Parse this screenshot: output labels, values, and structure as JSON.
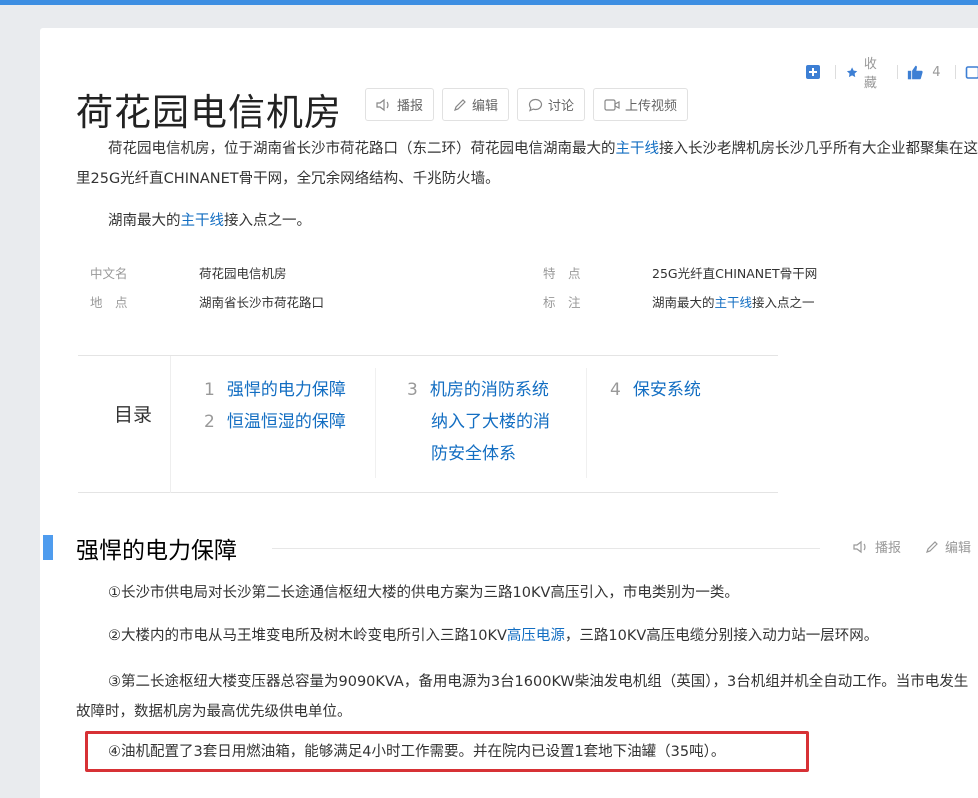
{
  "toolbar": {
    "favorite_label": "收藏",
    "like_count": "4"
  },
  "title": "荷花园电信机房",
  "title_buttons": {
    "broadcast": "播报",
    "edit": "编辑",
    "discuss": "讨论",
    "upload_video": "上传视频"
  },
  "summary": {
    "p1_a": "荷花园电信机房，位于湖南省长沙市荷花路口（东二环）荷花园电信湖南最大的",
    "p1_link": "主干线",
    "p1_b": "接入长沙老牌机房长沙几乎所有大企业都聚集在这里25G光纤直CHINANET骨干网，全冗余网络结构、千兆防火墙。",
    "p2_a": "湖南最大的",
    "p2_link": "主干线",
    "p2_b": "接入点之一。"
  },
  "infobox": {
    "left": [
      {
        "key": "中文名",
        "value": "荷花园电信机房"
      },
      {
        "key": "地　点",
        "value": "湖南省长沙市荷花路口"
      }
    ],
    "right": [
      {
        "key": "特　点",
        "value": "25G光纤直CHINANET骨干网"
      },
      {
        "key": "标　注",
        "value_a": "湖南最大的",
        "value_link": "主干线",
        "value_b": "接入点之一"
      }
    ]
  },
  "toc": {
    "label": "目录",
    "items": [
      {
        "num": "1",
        "text": "强悍的电力保障"
      },
      {
        "num": "2",
        "text": "恒温恒湿的保障"
      },
      {
        "num": "3",
        "line1": "机房的消防系统",
        "line2": "纳入了大楼的消",
        "line3": "防安全体系"
      },
      {
        "num": "4",
        "text": "保安系统"
      }
    ]
  },
  "section": {
    "title": "强悍的电力保障",
    "broadcast": "播报",
    "edit": "编辑",
    "p1": "①长沙市供电局对长沙第二长途通信枢纽大楼的供电方案为三路10KV高压引入，市电类别为一类。",
    "p2_a": "②大楼内的市电从马王堆变电所及树木岭变电所引入三路10KV",
    "p2_link": "高压电源",
    "p2_b": "，三路10KV高压电缆分别接入动力站一层环网。",
    "p3": "③第二长途枢纽大楼变压器总容量为9090KVA，备用电源为3台1600KW柴油发电机组（英国），3台机组并机全自动工作。当市电发生故障时，数据机房为最高优先级供电单位。",
    "p4": "④油机配置了3套日用燃油箱，能够满足4小时工作需要。并在院内已设置1套地下油罐（35吨）。"
  },
  "colors": {
    "accent": "#3d8ee2",
    "link": "#136ec2",
    "highlight_border": "#d73135"
  }
}
